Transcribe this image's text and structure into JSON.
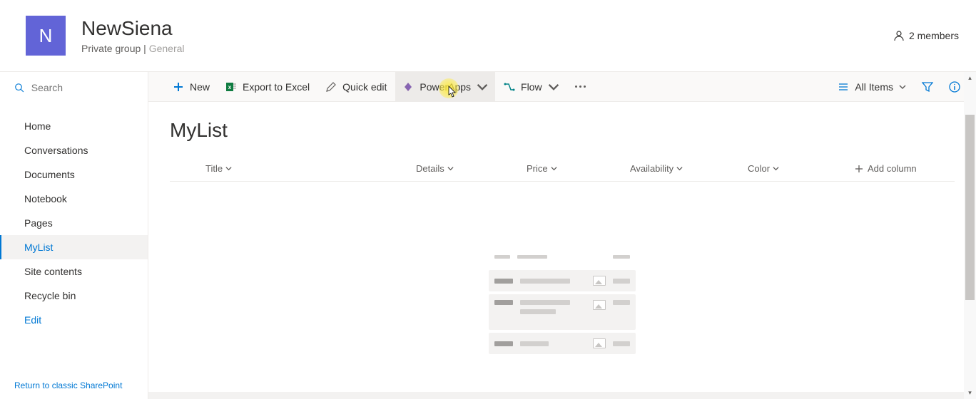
{
  "header": {
    "logo_letter": "N",
    "site_title": "NewSiena",
    "group_type": "Private group",
    "classification": "General",
    "members_label": "2 members"
  },
  "search": {
    "placeholder": "Search"
  },
  "nav": {
    "items": [
      {
        "label": "Home",
        "selected": false
      },
      {
        "label": "Conversations",
        "selected": false
      },
      {
        "label": "Documents",
        "selected": false
      },
      {
        "label": "Notebook",
        "selected": false
      },
      {
        "label": "Pages",
        "selected": false
      },
      {
        "label": "MyList",
        "selected": true
      },
      {
        "label": "Site contents",
        "selected": false
      },
      {
        "label": "Recycle bin",
        "selected": false
      },
      {
        "label": "Edit",
        "selected": false,
        "link": true
      }
    ],
    "footer": "Return to classic SharePoint"
  },
  "commands": {
    "new": "New",
    "export": "Export to Excel",
    "quickedit": "Quick edit",
    "powerapps": "PowerApps",
    "flow": "Flow",
    "view": "All Items"
  },
  "list": {
    "title": "MyList",
    "columns": [
      "Title",
      "Details",
      "Price",
      "Availability",
      "Color"
    ],
    "add_column": "Add column"
  }
}
